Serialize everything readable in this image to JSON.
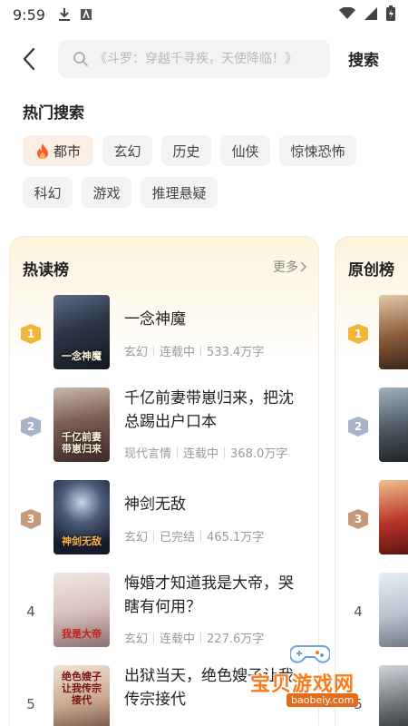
{
  "status_bar": {
    "time": "9:59"
  },
  "search": {
    "placeholder": "《斗罗：穿越千寻疾，天使降临！》",
    "submit_label": "搜索"
  },
  "hot_search": {
    "title": "热门搜索",
    "tags": [
      "都市",
      "玄幻",
      "历史",
      "仙侠",
      "惊悚恐怖",
      "科幻",
      "游戏",
      "推理悬疑"
    ]
  },
  "hot_read": {
    "title": "热读榜",
    "more_label": "更多",
    "books": [
      {
        "rank": "1",
        "title": "一念神魔",
        "genre": "玄幻",
        "status": "连载中",
        "words": "533.4万字",
        "cover_text": "一念神魔"
      },
      {
        "rank": "2",
        "title": "千亿前妻带崽归来，把沈总踢出户口本",
        "genre": "现代言情",
        "status": "连载中",
        "words": "368.0万字",
        "cover_text": "千亿前妻带崽归来"
      },
      {
        "rank": "3",
        "title": "神剑无敌",
        "genre": "玄幻",
        "status": "已完结",
        "words": "465.1万字",
        "cover_text": "神剑无敌"
      },
      {
        "rank": "4",
        "title": "悔婚才知道我是大帝，哭瞎有何用？",
        "genre": "玄幻",
        "status": "连载中",
        "words": "227.6万字",
        "cover_text": "我是大帝"
      },
      {
        "rank": "5",
        "title": "出狱当天，绝色嫂子让我传宗接代",
        "genre": "",
        "status": "",
        "words": "",
        "cover_text": "绝色嫂子让我传宗接代"
      }
    ]
  },
  "original": {
    "title": "原创榜",
    "ranks": [
      "1",
      "2",
      "3",
      "4",
      "5"
    ]
  },
  "watermark": {
    "text": "宝贝游戏网",
    "url": "baobeiy.com"
  }
}
